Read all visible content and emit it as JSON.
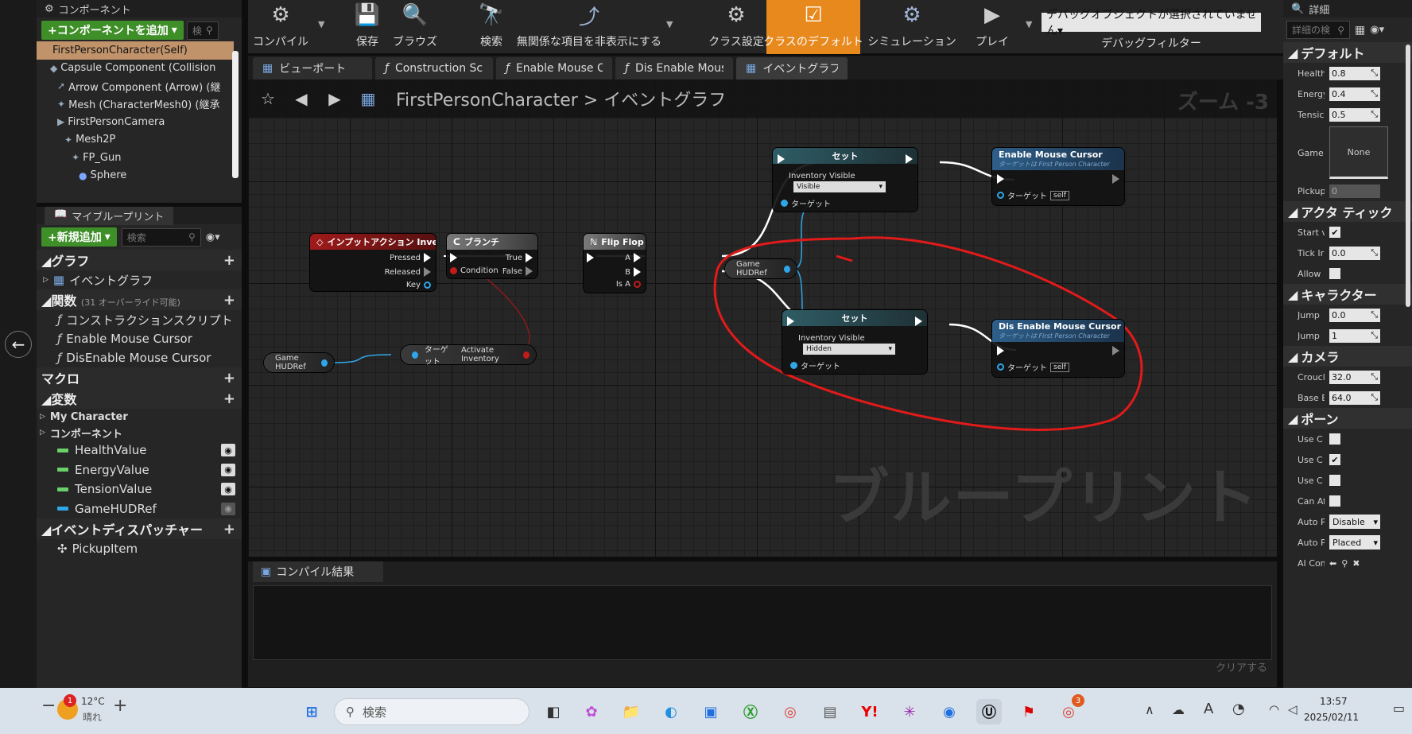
{
  "components_panel": {
    "title": "コンポーネント",
    "add_button": "+コンポーネントを追加",
    "search_placeholder": "検",
    "items": [
      {
        "label": "FirstPersonCharacter(Self)",
        "icon": "self-icon",
        "indent": 0
      },
      {
        "label": "Capsule Component (Collision",
        "icon": "capsule-icon",
        "indent": 1
      },
      {
        "label": "Arrow Component (Arrow) (継",
        "icon": "arrow-component-icon",
        "indent": 2
      },
      {
        "label": "Mesh (CharacterMesh0) (継承",
        "icon": "mesh-icon",
        "indent": 2
      },
      {
        "label": "FirstPersonCamera",
        "icon": "camera-icon",
        "indent": 2
      },
      {
        "label": "Mesh2P",
        "icon": "mesh-icon",
        "indent": 3
      },
      {
        "label": "FP_Gun",
        "icon": "mesh-icon",
        "indent": 4
      },
      {
        "label": "Sphere",
        "icon": "sphere-icon",
        "indent": 5
      }
    ]
  },
  "my_blueprint": {
    "title": "マイブループリント",
    "add_new": "+新規追加",
    "search_placeholder": "検索",
    "graph_section": "グラフ",
    "event_graph": "イベントグラフ",
    "functions_section": "関数",
    "functions_note": "(31 オーバーライド可能)",
    "functions": [
      "コンストラクションスクリプト",
      "Enable Mouse Cursor",
      "DisEnable Mouse Cursor"
    ],
    "macros_section": "マクロ",
    "variables_section": "変数",
    "variable_groups": [
      "My Character",
      "コンポーネント"
    ],
    "variables": [
      {
        "label": "HealthValue",
        "color": "#6ad06a"
      },
      {
        "label": "EnergyValue",
        "color": "#6ad06a"
      },
      {
        "label": "TensionValue",
        "color": "#6ad06a"
      },
      {
        "label": "GameHUDRef",
        "color": "#2fa6e8"
      }
    ],
    "dispatchers_section": "イベントディスパッチャー",
    "dispatchers": [
      "PickupItem"
    ]
  },
  "toolbar": {
    "buttons": [
      {
        "label": "コンパイル",
        "icon": "compile-icon"
      },
      {
        "label": "保存",
        "icon": "save-icon"
      },
      {
        "label": "ブラウズ",
        "icon": "browse-icon"
      },
      {
        "label": "検索",
        "icon": "find-icon"
      },
      {
        "label": "無関係な項目を非表示にする",
        "icon": "hide-unrelated-icon"
      },
      {
        "label": "クラス設定",
        "icon": "class-settings-icon"
      },
      {
        "label": "クラスのデフォルト",
        "icon": "class-defaults-icon"
      },
      {
        "label": "シミュレーション",
        "icon": "simulation-icon"
      },
      {
        "label": "プレイ",
        "icon": "play-icon"
      }
    ],
    "debug_select": "デバッグオブジェクトが選択されていません▾",
    "debug_filter_label": "デバッグフィルター"
  },
  "tabs": [
    {
      "label": "ビューポート",
      "icon": "viewport-icon"
    },
    {
      "label": "Construction Scrip",
      "icon": "function-icon"
    },
    {
      "label": "Enable Mouse Cur",
      "icon": "function-icon"
    },
    {
      "label": "Dis Enable Mouse",
      "icon": "function-icon"
    },
    {
      "label": "イベントグラフ",
      "icon": "event-graph-icon"
    }
  ],
  "graph": {
    "breadcrumb": "FirstPersonCharacter > イベントグラフ",
    "zoom": "ズーム -3",
    "watermark": "ブループリント",
    "nodes": {
      "input_action": {
        "title": "インプットアクション Inventory",
        "pressed": "Pressed",
        "released": "Released",
        "key": "Key"
      },
      "branch": {
        "title": "ブランチ",
        "condition": "Condition",
        "true": "True",
        "false": "False"
      },
      "flipflop": {
        "title": "Flip Flop",
        "a": "A",
        "b": "B",
        "is_a": "Is A"
      },
      "set_visible": {
        "title": "セット",
        "prop": "Inventory Visible",
        "value": "Visible",
        "target": "ターゲット"
      },
      "set_hidden": {
        "title": "セット",
        "prop": "Inventory Visible",
        "value": "Hidden",
        "target": "ターゲット"
      },
      "enable_cursor": {
        "title": "Enable Mouse Cursor",
        "sub": "ターゲットは First Person Character",
        "target": "ターゲット",
        "self": "self"
      },
      "disable_cursor": {
        "title": "Dis Enable Mouse Cursor",
        "sub": "ターゲットは First Person Character",
        "target": "ターゲット",
        "self": "self"
      },
      "activate_inventory": {
        "target": "ターゲット",
        "label": "Activate Inventory"
      },
      "hud_ref_left": "Game HUDRef",
      "hud_ref_mid": "Game HUDRef"
    }
  },
  "compile_results": {
    "tab": "コンパイル結果",
    "clear": "クリアする"
  },
  "details": {
    "title": "詳細",
    "search_placeholder": "詳細の検",
    "default_section": "デフォルト",
    "defaults": [
      {
        "label": "Health",
        "value": "0.8"
      },
      {
        "label": "Energy",
        "value": "0.4"
      },
      {
        "label": "Tensic",
        "value": "0.5"
      }
    ],
    "game_label": "Game",
    "game_value": "None",
    "pickup_label": "Pickup",
    "pickup_value": "0",
    "actor_tick_section": "アクタ ティック",
    "actor_tick": [
      {
        "label": "Start v",
        "type": "check",
        "checked": true
      },
      {
        "label": "Tick Ir",
        "type": "num",
        "value": "0.0"
      },
      {
        "label": "Allow",
        "type": "check",
        "checked": false
      }
    ],
    "character_section": "キャラクター",
    "character": [
      {
        "label": "Jump",
        "value": "0.0"
      },
      {
        "label": "Jump",
        "value": "1"
      }
    ],
    "camera_section": "カメラ",
    "camera": [
      {
        "label": "Croucl",
        "value": "32.0"
      },
      {
        "label": "Base E",
        "value": "64.0"
      }
    ],
    "pawn_section": "ポーン",
    "pawn": [
      {
        "label": "Use C",
        "type": "check",
        "checked": false
      },
      {
        "label": "Use C",
        "type": "check",
        "checked": true
      },
      {
        "label": "Use C",
        "type": "check",
        "checked": false
      },
      {
        "label": "Can Af",
        "type": "check",
        "checked": false
      },
      {
        "label": "Auto P",
        "type": "dd",
        "value": "Disable"
      },
      {
        "label": "Auto P",
        "type": "dd",
        "value": "Placed"
      },
      {
        "label": "AI Con",
        "type": "icons"
      }
    ]
  },
  "taskbar": {
    "weather_temp": "12°C",
    "weather_desc": "晴れ",
    "weather_badge": "1",
    "search_placeholder": "検索",
    "time": "13:57",
    "date": "2025/02/11",
    "ime": "A",
    "chrome_badge": "3"
  }
}
